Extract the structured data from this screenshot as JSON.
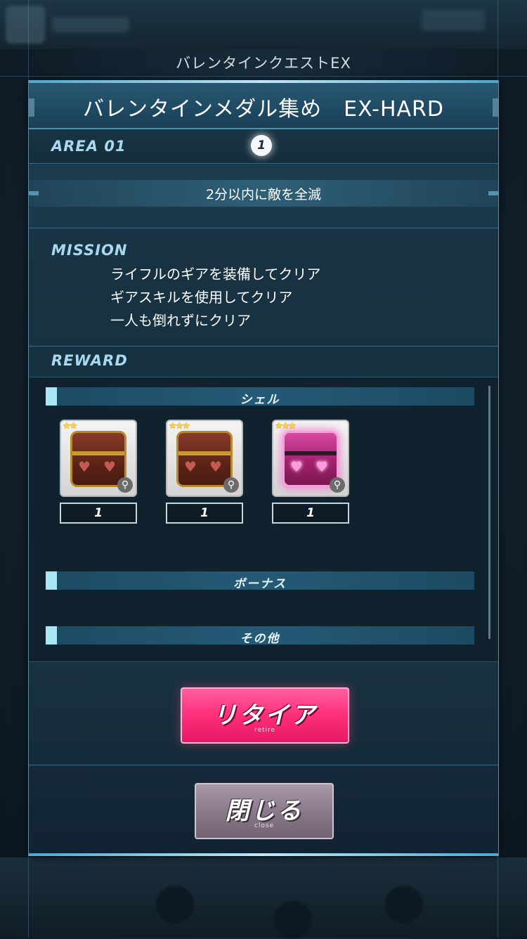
{
  "screen_title": "バレンタインクエストEX",
  "quest": {
    "title": "バレンタインメダル集め　EX-HARD",
    "area_label": "AREA 01",
    "area_number": "1",
    "objective": "2分以内に敵を全滅"
  },
  "mission": {
    "label": "MISSION",
    "items": [
      "ライフルのギアを装備してクリア",
      "ギアスキルを使用してクリア",
      "一人も倒れずにクリア"
    ]
  },
  "reward": {
    "label": "REWARD",
    "categories": {
      "shell": "シェル",
      "bonus": "ボーナス",
      "other": "その他"
    },
    "items": [
      {
        "stars": "★★",
        "icon": "heart-chest-icon",
        "quantity": "1"
      },
      {
        "stars": "★★★",
        "icon": "heart-chest-icon",
        "quantity": "1"
      },
      {
        "stars": "★★★",
        "icon": "pink-heart-chest-icon",
        "quantity": "1"
      }
    ]
  },
  "buttons": {
    "retire_label": "リタイア",
    "retire_sub": "retire",
    "close_label": "閉じる",
    "close_sub": "close"
  },
  "colors": {
    "accent": "#a9d9ee",
    "retire": "#ff2e7a",
    "close": "#8a7a8a"
  }
}
